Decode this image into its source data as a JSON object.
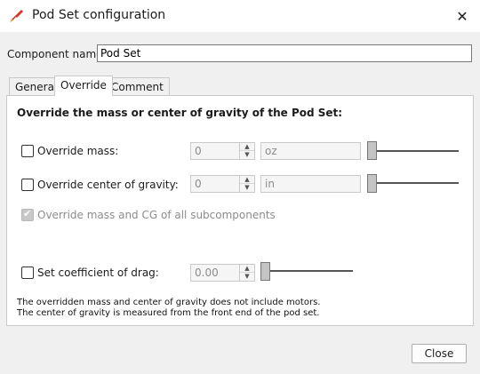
{
  "window": {
    "title": "Pod Set configuration",
    "close_glyph": "✕"
  },
  "component": {
    "label": "Component name:",
    "value": "Pod Set"
  },
  "tabs": [
    {
      "label": "General",
      "active": false
    },
    {
      "label": "Override",
      "active": true
    },
    {
      "label": "Comment",
      "active": false
    }
  ],
  "override": {
    "heading": "Override the mass or center of gravity of the Pod Set:",
    "mass": {
      "label": "Override mass:",
      "value": "0",
      "unit": "oz",
      "checked": false
    },
    "cg": {
      "label": "Override center of gravity:",
      "value": "0",
      "unit": "in",
      "checked": false
    },
    "subcomponents": {
      "label": "Override mass and CG of all subcomponents",
      "checked": true,
      "disabled": true
    },
    "drag": {
      "label": "Set coefficient of drag:",
      "value": "0.00",
      "checked": false
    },
    "note_line1": "The overridden mass and center of gravity does not include motors.",
    "note_line2": "The center of gravity is measured from the front end of the pod set."
  },
  "buttons": {
    "close": "Close"
  },
  "colors": {
    "window_bg": "#f0f0f0",
    "titlebar_bg": "#ffffff",
    "panel_bg": "#ffffff",
    "disabled_text": "#8c8c8c"
  }
}
